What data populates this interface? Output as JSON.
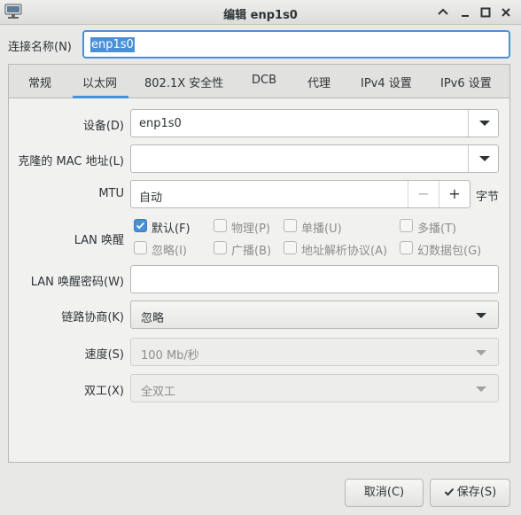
{
  "window": {
    "title": "编辑 enp1s0",
    "app_icon": "network-icon",
    "controls": [
      "chevron-up-icon",
      "minimize-icon",
      "maximize-icon",
      "close-icon"
    ]
  },
  "connection": {
    "label": "连接名称(N)",
    "value": "enp1s0"
  },
  "tabs": [
    {
      "label": "常规"
    },
    {
      "label": "以太网"
    },
    {
      "label": "802.1X 安全性"
    },
    {
      "label": "DCB"
    },
    {
      "label": "代理"
    },
    {
      "label": "IPv4 设置"
    },
    {
      "label": "IPv6 设置"
    }
  ],
  "active_tab": "以太网",
  "form": {
    "device": {
      "label": "设备(D)",
      "value": "enp1s0"
    },
    "cloned_mac": {
      "label": "克隆的 MAC 地址(L)",
      "value": ""
    },
    "mtu": {
      "label": "MTU",
      "value": "自动",
      "unit": "字节",
      "minus": "−",
      "plus": "+"
    },
    "wol": {
      "label": "LAN 唤醒",
      "options": [
        {
          "label": "默认(F)",
          "checked": true
        },
        {
          "label": "物理(P)",
          "checked": false
        },
        {
          "label": "单播(U)",
          "checked": false
        },
        {
          "label": "多播(T)",
          "checked": false
        },
        {
          "label": "忽略(I)",
          "checked": false
        },
        {
          "label": "广播(B)",
          "checked": false
        },
        {
          "label": "地址解析协议(A)",
          "checked": false
        },
        {
          "label": "幻数据包(G)",
          "checked": false
        }
      ]
    },
    "wol_password": {
      "label": "LAN 唤醒密码(W)",
      "value": ""
    },
    "link_negotiation": {
      "label": "链路协商(K)",
      "value": "忽略"
    },
    "speed": {
      "label": "速度(S)",
      "value": "100 Mb/秒"
    },
    "duplex": {
      "label": "双工(X)",
      "value": "全双工"
    }
  },
  "buttons": {
    "cancel": "取消(C)",
    "save": "保存(S)"
  },
  "colors": {
    "accent": "#4a90d9",
    "text": "#2e3436",
    "disabled_text": "#8d8f8a"
  }
}
